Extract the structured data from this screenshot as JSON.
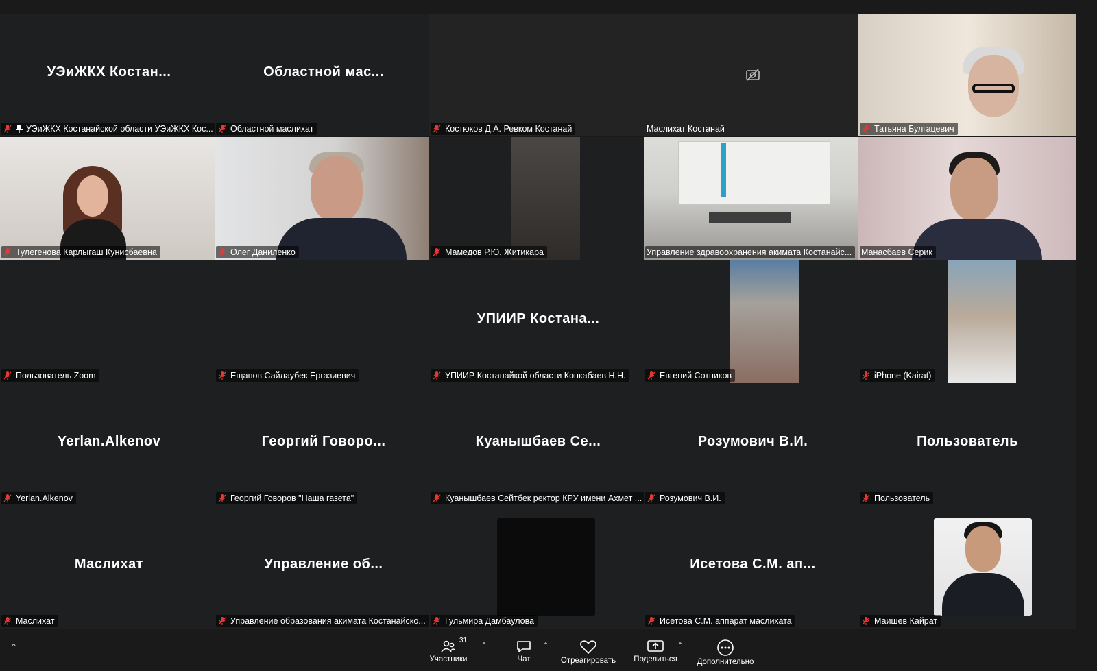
{
  "tiles": [
    {
      "big": "УЭиЖКХ  Костан...",
      "label": "УЭиЖКХ Костанайской области УЭиЖКХ Кос...",
      "pinned": true
    },
    {
      "big": "Областной  мас...",
      "label": "Областной маслихат"
    },
    {
      "big": "",
      "label": "Костюков Д.А. Ревком Костанай"
    },
    {
      "big": "",
      "label": "Маслихат Костанай",
      "cam_off": true
    },
    {
      "big": "",
      "label": "Татьяна Булгацевич"
    },
    {
      "big": "",
      "label": "Тулегенова Карлыгаш Кунисбаевна"
    },
    {
      "big": "",
      "label": "Олег Даниленко"
    },
    {
      "big": "",
      "label": "Мамедов Р.Ю. Житикара"
    },
    {
      "big": "",
      "label": "Управление здравоохранения акимата Костанайс..."
    },
    {
      "big": "",
      "label": "Манасбаев Серик",
      "active_speaker": true
    },
    {
      "big": "",
      "label": "Пользователь Zoom"
    },
    {
      "big": "",
      "label": "Ещанов Сайлаубек Ергазиевич"
    },
    {
      "big": "УПИИР  Костана...",
      "label": "УПИИР Костанайкой области  Конкабаев Н.Н."
    },
    {
      "big": "",
      "label": "Евгений Сотников"
    },
    {
      "big": "",
      "label": "iPhone (Kairat)"
    },
    {
      "big": "Yerlan.Alkenov",
      "label": "Yerlan.Alkenov"
    },
    {
      "big": "Георгий  Говоро...",
      "label": "Георгий Говоров \"Наша газета\""
    },
    {
      "big": "Куанышбаев  Се...",
      "label": "Куанышбаев Сейтбек ректор КРУ имени Ахмет ..."
    },
    {
      "big": "Розумович В.И.",
      "label": "Розумович В.И."
    },
    {
      "big": "Пользователь",
      "label": "Пользователь"
    },
    {
      "big": "Маслихат",
      "label": "Маслихат"
    },
    {
      "big": "Управление  об...",
      "label": "Управление образования акимата Костанайско..."
    },
    {
      "big": "",
      "label": "Гульмира Дамбаулова"
    },
    {
      "big": "Исетова С.М. ап...",
      "label": "Исетова С.М. аппарат маслихата"
    },
    {
      "big": "",
      "label": "Маишев Кайрат"
    }
  ],
  "toolbar": {
    "participants_label": "Участники",
    "participants_count": "31",
    "chat_label": "Чат",
    "react_label": "Отреагировать",
    "share_label": "Поделиться",
    "more_label": "Дополнительно"
  },
  "colors": {
    "active_speaker_border": "#3ccf86",
    "muted_icon": "#e53935",
    "background": "#1a1a1a"
  },
  "icons": {
    "muted": "mic-muted-icon",
    "pin": "pin-icon",
    "camera_off": "camera-off-icon",
    "participants": "participants-icon",
    "chat": "chat-icon",
    "react": "heart-icon",
    "share": "share-screen-icon",
    "more": "more-icon"
  }
}
